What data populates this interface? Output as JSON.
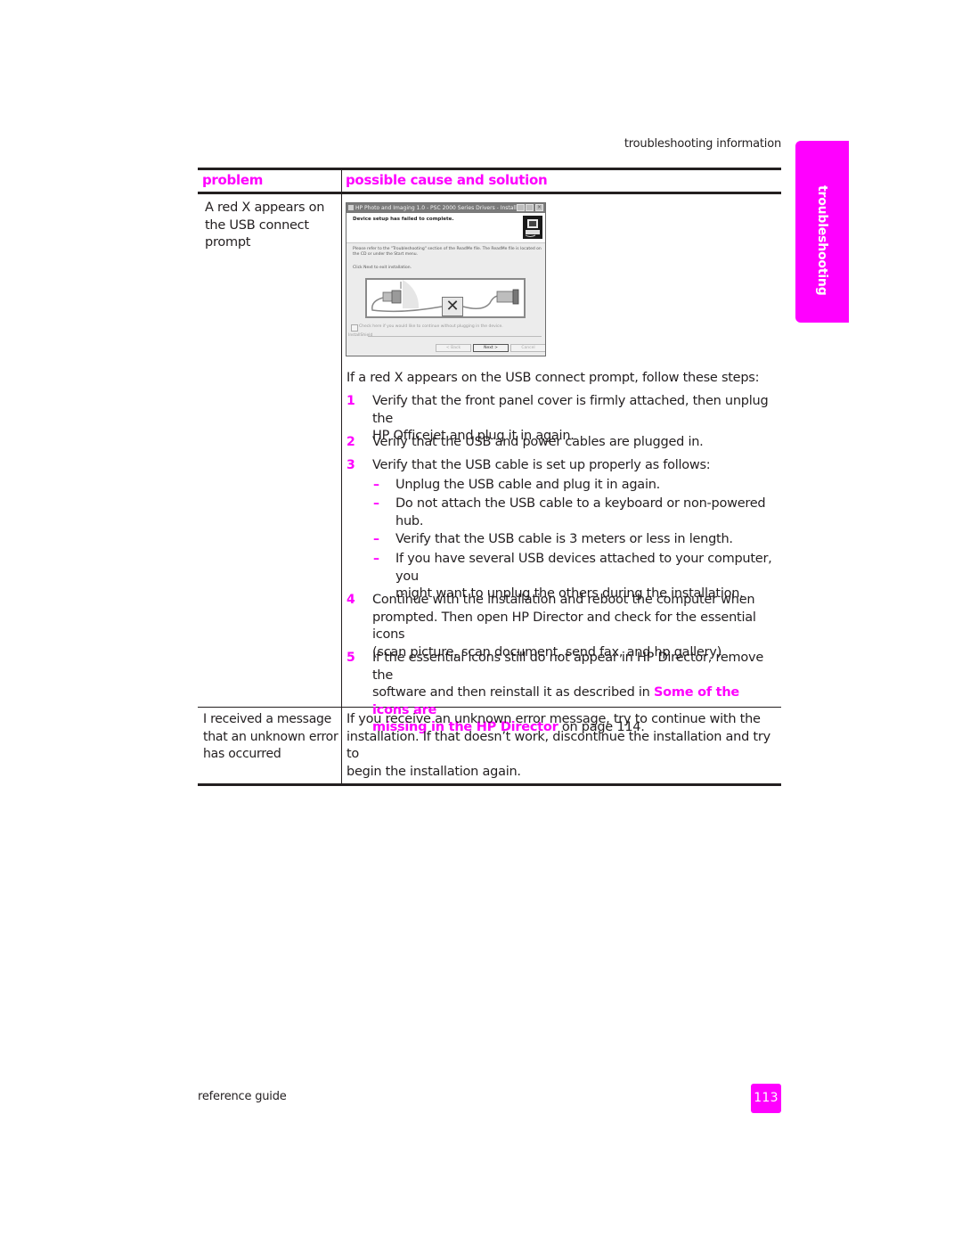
{
  "page": {
    "running_header": "troubleshooting information",
    "side_tab": "troubleshooting",
    "footer_left": "reference guide",
    "page_number": "113",
    "accent_color": "#ff00ff"
  },
  "table": {
    "headers": {
      "problem": "problem",
      "solution": "possible cause and solution"
    },
    "rows": [
      {
        "problem": "A red X appears on the USB connect prompt",
        "problem_lines": [
          "A red X appears on",
          "the USB connect",
          "prompt"
        ],
        "dialog": {
          "title": "HP Photo and Imaging 1.0 - PSC 2000 Series Drivers - InstallSh...",
          "header": "Device setup has failed to complete.",
          "body_line_1": "Please refer to the \"Troubleshooting\" section of the ReadMe file.  The ReadMe file is located on",
          "body_line_2": "the CD or under the Start menu.",
          "instruction": "Click Next to exit installation.",
          "checkbox_label": "Check here if you would like to continue without plugging in the device.",
          "group_label": "InstallShield",
          "back_label": "< Back",
          "next_label": "Next >",
          "cancel_label": "Cancel",
          "x_glyph": "✕"
        },
        "intro": "If a red X appears on the USB connect prompt, follow these steps:",
        "steps": [
          {
            "num": "1",
            "lines": [
              "Verify that the front panel cover is firmly attached, then unplug the",
              "HP Officejet and plug it in again."
            ]
          },
          {
            "num": "2",
            "lines": [
              "Verify that the USB and power cables are plugged in."
            ]
          },
          {
            "num": "3",
            "lines": [
              "Verify that the USB cable is set up properly as follows:"
            ]
          },
          {
            "num": "4",
            "lines": [
              "Continue with the installation and reboot the computer when",
              "prompted. Then open HP Director and check for the essential icons",
              "(scan picture, scan document, send fax, and hp gallery)"
            ]
          },
          {
            "num": "5",
            "line1": "If the essential icons still do not appear in HP Director, remove the",
            "line2_pre": "software and then reinstall it as described in ",
            "line2_link": "Some of the icons are",
            "line3_link": "missing in the HP Director",
            "line3_post": " on page 114."
          }
        ],
        "sub_bullets": [
          {
            "dash": "–",
            "lines": [
              "Unplug the USB cable and plug it in again."
            ]
          },
          {
            "dash": "–",
            "lines": [
              "Do not attach the USB cable to a keyboard or non-powered",
              "hub."
            ]
          },
          {
            "dash": "–",
            "lines": [
              "Verify that the USB cable is 3 meters or less in length."
            ]
          },
          {
            "dash": "–",
            "lines": [
              "If you have several USB devices attached to your computer, you",
              "might want to unplug the others during the installation."
            ]
          }
        ]
      },
      {
        "problem_lines": [
          "I received a message",
          "that an unknown error",
          "has occurred"
        ],
        "solution_lines": [
          "If you receive an unknown error message, try to continue with the",
          "installation. If that doesn’t work, discontinue the installation and try to",
          "begin the installation again."
        ]
      }
    ]
  }
}
